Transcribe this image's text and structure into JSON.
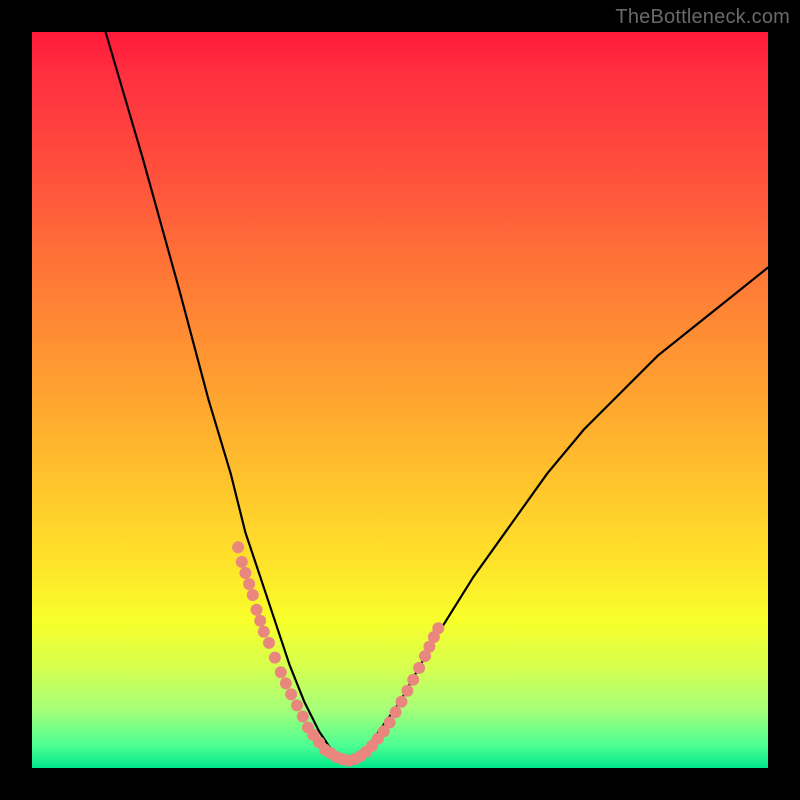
{
  "watermark": "TheBottleneck.com",
  "colors": {
    "frame": "#000000",
    "gradient_top": "#ff1a3a",
    "gradient_bottom": "#00e68a",
    "curve": "#000000",
    "dots": "#e9877f"
  },
  "chart_data": {
    "type": "line",
    "title": "",
    "xlabel": "",
    "ylabel": "",
    "xlim": [
      0,
      100
    ],
    "ylim": [
      0,
      100
    ],
    "series": [
      {
        "name": "bottleneck-curve",
        "x": [
          10,
          15,
          20,
          24,
          27,
          29,
          31,
          33,
          35,
          37,
          39,
          41,
          43,
          45,
          50,
          55,
          60,
          65,
          70,
          75,
          80,
          85,
          90,
          95,
          100
        ],
        "y": [
          100,
          83,
          65,
          50,
          40,
          32,
          26,
          20,
          14,
          9,
          5,
          2,
          1,
          2,
          9,
          18,
          26,
          33,
          40,
          46,
          51,
          56,
          60,
          64,
          68
        ]
      }
    ],
    "dot_clusters": [
      {
        "name": "left-cluster",
        "points": [
          [
            28.0,
            30.0
          ],
          [
            28.5,
            28.0
          ],
          [
            29.0,
            26.5
          ],
          [
            29.5,
            25.0
          ],
          [
            30.0,
            23.5
          ],
          [
            30.5,
            21.5
          ],
          [
            31.0,
            20.0
          ],
          [
            31.5,
            18.5
          ],
          [
            32.2,
            17.0
          ],
          [
            33.0,
            15.0
          ],
          [
            33.8,
            13.0
          ],
          [
            34.5,
            11.5
          ],
          [
            35.2,
            10.0
          ],
          [
            36.0,
            8.5
          ],
          [
            36.8,
            7.0
          ],
          [
            37.5,
            5.5
          ],
          [
            38.2,
            4.5
          ],
          [
            39.0,
            3.5
          ],
          [
            39.8,
            2.5
          ],
          [
            40.6,
            2.0
          ],
          [
            41.4,
            1.5
          ],
          [
            42.2,
            1.2
          ],
          [
            43.0,
            1.0
          ]
        ]
      },
      {
        "name": "right-cluster",
        "points": [
          [
            43.8,
            1.2
          ],
          [
            44.6,
            1.6
          ],
          [
            45.4,
            2.2
          ],
          [
            46.2,
            3.0
          ],
          [
            47.0,
            4.0
          ],
          [
            47.8,
            5.0
          ],
          [
            48.6,
            6.2
          ],
          [
            49.4,
            7.6
          ],
          [
            50.2,
            9.0
          ],
          [
            51.0,
            10.5
          ],
          [
            51.8,
            12.0
          ],
          [
            52.6,
            13.6
          ],
          [
            53.4,
            15.2
          ],
          [
            54.0,
            16.5
          ],
          [
            54.6,
            17.8
          ],
          [
            55.2,
            19.0
          ]
        ]
      }
    ]
  }
}
